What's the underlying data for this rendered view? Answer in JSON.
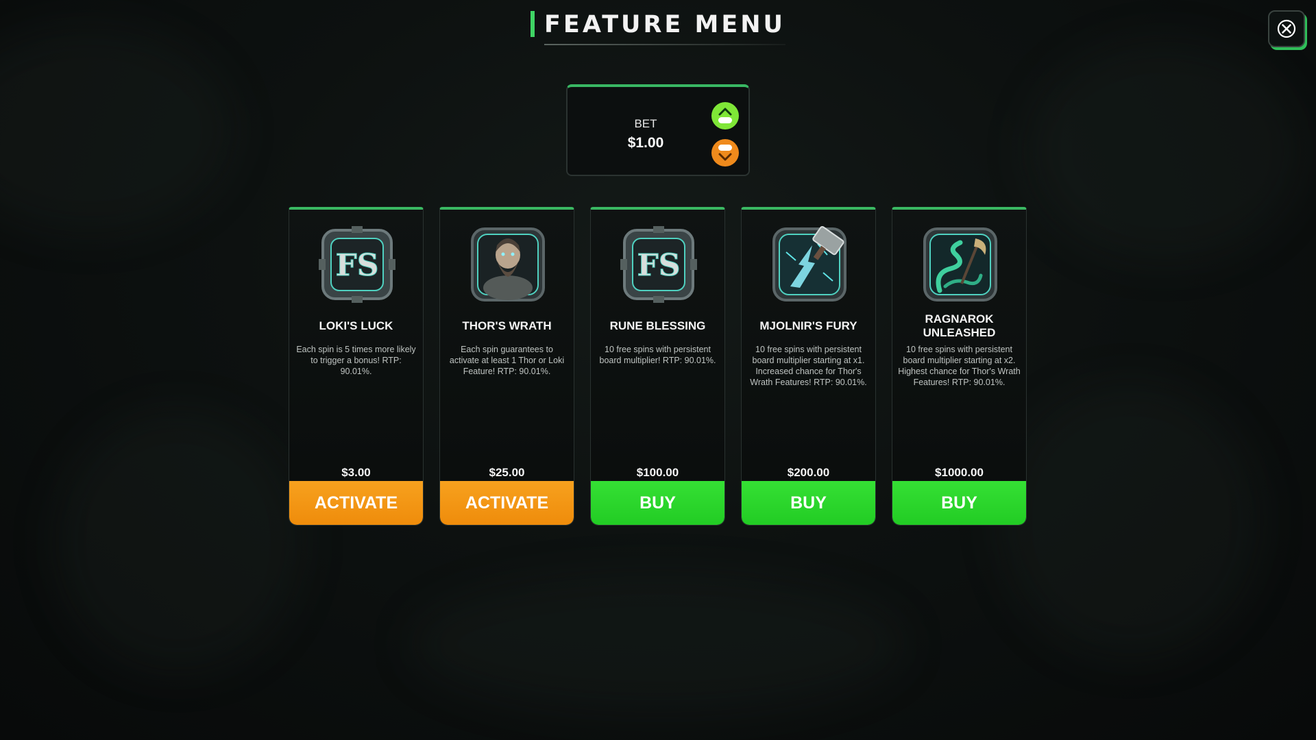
{
  "title": "FEATURE MENU",
  "bet": {
    "label": "BET",
    "value": "$1.00"
  },
  "colors": {
    "accent": "#3ab862",
    "activate": "#ef8c0b",
    "buy": "#22cc24",
    "bet_up": "#7fe637",
    "bet_down": "#ef8a1c"
  },
  "cards": [
    {
      "icon": "fs-rune-icon",
      "title": "LOKI'S LUCK",
      "description": "Each spin is 5 times more likely to trigger a bonus! RTP: 90.01%.",
      "price": "$3.00",
      "button": "ACTIVATE",
      "button_color": "orange"
    },
    {
      "icon": "thor-portrait-icon",
      "title": "THOR'S WRATH",
      "description": "Each spin guarantees to activate at least 1 Thor or Loki Feature! RTP: 90.01%.",
      "price": "$25.00",
      "button": "ACTIVATE",
      "button_color": "orange"
    },
    {
      "icon": "fs-rune-icon",
      "title": "RUNE BLESSING",
      "description": "10 free spins with persistent board multiplier! RTP: 90.01%.",
      "price": "$100.00",
      "button": "BUY",
      "button_color": "green"
    },
    {
      "icon": "hammer-lightning-icon",
      "title": "MJOLNIR'S FURY",
      "description": "10 free spins with persistent board multiplier starting at x1. Increased chance for Thor's Wrath Features! RTP: 90.01%.",
      "price": "$200.00",
      "button": "BUY",
      "button_color": "green"
    },
    {
      "icon": "serpent-axe-icon",
      "title": "RAGNAROK UNLEASHED",
      "description": "10 free spins with persistent board multiplier starting at x2. Highest chance for Thor's Wrath Features! RTP: 90.01%.",
      "price": "$1000.00",
      "button": "BUY",
      "button_color": "green"
    }
  ]
}
